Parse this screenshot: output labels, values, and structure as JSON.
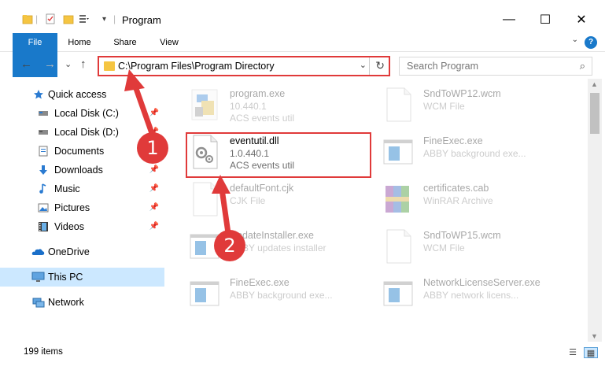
{
  "window": {
    "title": "Program",
    "minimize": "—",
    "maximize": "☐",
    "close": "✕"
  },
  "ribbon": {
    "tabs": [
      "File",
      "Home",
      "Share",
      "View"
    ],
    "help": "?",
    "collapse": "⌄"
  },
  "nav": {
    "back": "←",
    "forward": "→",
    "recent": "⌄",
    "up": "↑"
  },
  "address": {
    "path": "C:\\Program Files\\Program Directory",
    "dropdown": "⌄",
    "refresh": "↻"
  },
  "search": {
    "placeholder": "Search Program",
    "icon": "⌕"
  },
  "sidebar": {
    "items": [
      {
        "label": "Quick access",
        "icon": "star-icon",
        "pinned": false
      },
      {
        "label": "Local Disk (C:)",
        "icon": "drive-icon",
        "pinned": true
      },
      {
        "label": "Local Disk (D:)",
        "icon": "drive-icon",
        "pinned": true
      },
      {
        "label": "Documents",
        "icon": "documents-icon",
        "pinned": true
      },
      {
        "label": "Downloads",
        "icon": "downloads-icon",
        "pinned": true
      },
      {
        "label": "Music",
        "icon": "music-icon",
        "pinned": true
      },
      {
        "label": "Pictures",
        "icon": "pictures-icon",
        "pinned": true
      },
      {
        "label": "Videos",
        "icon": "videos-icon",
        "pinned": true
      },
      {
        "label": "OneDrive",
        "icon": "onedrive-icon",
        "pinned": false
      },
      {
        "label": "This PC",
        "icon": "pc-icon",
        "pinned": false,
        "selected": true
      },
      {
        "label": "Network",
        "icon": "network-icon",
        "pinned": false
      }
    ],
    "pin_glyph": "📌"
  },
  "files": [
    {
      "name": "program.exe",
      "line2": "10.440.1",
      "line3": "ACS events util",
      "icon": "exe-icon"
    },
    {
      "name": "SndToWP12.wcm",
      "line2": "WCM File",
      "line3": "",
      "icon": "blank-file-icon"
    },
    {
      "name": "eventutil.dll",
      "line2": "1.0.440.1",
      "line3": "ACS events util",
      "icon": "dll-icon",
      "highlighted": true
    },
    {
      "name": "FineExec.exe",
      "line2": "ABBY background exe...",
      "line3": "",
      "icon": "app-window-icon"
    },
    {
      "name": "defaultFont.cjk",
      "line2": "CJK File",
      "line3": "",
      "icon": "blank-file-icon"
    },
    {
      "name": "certificates.cab",
      "line2": "WinRAR Archive",
      "line3": "",
      "icon": "archive-icon"
    },
    {
      "name": "UpdateInstaller.exe",
      "line2": "ABBY updates installer",
      "line3": "",
      "icon": "app-window-icon"
    },
    {
      "name": "SndToWP15.wcm",
      "line2": "WCM File",
      "line3": "",
      "icon": "blank-file-icon"
    },
    {
      "name": "FineExec.exe",
      "line2": "ABBY background exe...",
      "line3": "",
      "icon": "app-window-icon"
    },
    {
      "name": "NetworkLicenseServer.exe",
      "line2": "ABBY network licens...",
      "line3": "",
      "icon": "app-window-icon"
    }
  ],
  "status": {
    "count": "199 items"
  },
  "annotations": {
    "step1": "1",
    "step2": "2"
  },
  "colors": {
    "accent": "#1979ca",
    "highlight": "#e03a3a",
    "selected_bg": "#cce8ff",
    "folder": "#f5c542"
  }
}
